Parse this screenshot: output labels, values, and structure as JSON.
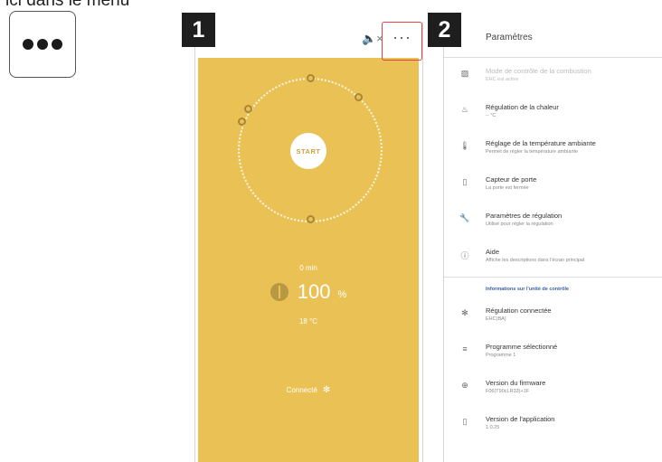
{
  "caption": "ici dans le menu",
  "steps": [
    "1",
    "2"
  ],
  "screen1": {
    "start_label": "START",
    "time": "0 min",
    "power_value": "100",
    "power_unit": "%",
    "temperature": "18 °C",
    "status": "Connecté"
  },
  "screen2": {
    "title": "Paramètres",
    "items": [
      {
        "icon": "combustion-icon",
        "title": "Mode de contrôle de la combustion",
        "subtitle": "EHC est active",
        "disabled": true
      },
      {
        "icon": "flame-icon",
        "title": "Régulation de la chaleur",
        "subtitle": "-- °C"
      },
      {
        "icon": "thermometer-icon",
        "title": "Réglage de la température ambiante",
        "subtitle": "Permet de régler la température ambiante"
      },
      {
        "icon": "door-icon",
        "title": "Capteur de porte",
        "subtitle": "La porte est fermée"
      },
      {
        "icon": "wrench-icon",
        "title": "Paramètres de régulation",
        "subtitle": "Utilisé pour régler la régulation"
      },
      {
        "icon": "info-icon",
        "title": "Aide",
        "subtitle": "Affiche les descriptions dans l'écran principal"
      }
    ],
    "section_header": "Informations sur l'unité de contrôle",
    "info_items": [
      {
        "icon": "bluetooth-icon",
        "title": "Régulation connectée",
        "subtitle": "EHC(BA)"
      },
      {
        "icon": "program-icon",
        "title": "Programme sélectionné",
        "subtitle": "Programme 1"
      },
      {
        "icon": "firmware-icon",
        "title": "Version du firmware",
        "subtitle": "F06(T90cLR33)+1F"
      },
      {
        "icon": "phone-icon",
        "title": "Version de l'application",
        "subtitle": "1.0.25"
      }
    ]
  },
  "colors": {
    "accent": "#eac154",
    "highlight": "#e04444",
    "badge": "#1e1e1e",
    "section": "#3b5fa6"
  }
}
